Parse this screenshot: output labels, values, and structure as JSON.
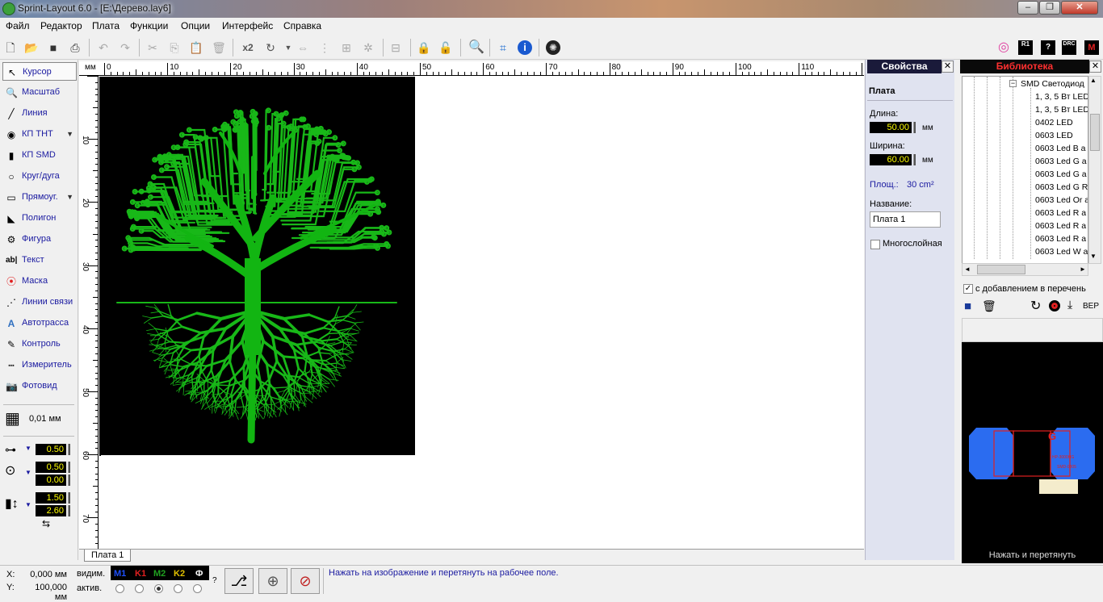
{
  "window": {
    "title": "Sprint-Layout 6.0 - [E:\\Дерево.lay6]",
    "min": "–",
    "max": "❐",
    "close": "✕"
  },
  "menu": [
    "Файл",
    "Редактор",
    "Плата",
    "Функции",
    "Опции",
    "Интерфейс",
    "Справка"
  ],
  "toolbar": {
    "x2": "x2",
    "ber": "BEP"
  },
  "tools": [
    "Курсор",
    "Масштаб",
    "Линия",
    "КП THT",
    "КП SMD",
    "Круг/дуга",
    "Прямоуг.",
    "Полигон",
    "Фигура",
    "Текст",
    "Маска",
    "Линии связи",
    "Автотрасса",
    "Контроль",
    "Измеритель",
    "Фотовид"
  ],
  "grid": {
    "value": "0,01 мм"
  },
  "params": {
    "track": "0.50",
    "pad_outer": "0.50",
    "pad_inner": "0.00",
    "smd_w": "1.50",
    "smd_h": "2.60"
  },
  "ruler": {
    "unit": "мм",
    "top": [
      "0",
      "10",
      "20",
      "30",
      "40",
      "50",
      "60",
      "70",
      "80",
      "90",
      "100",
      "110"
    ],
    "left": [
      "10",
      "20",
      "30",
      "40",
      "50",
      "60",
      "70"
    ]
  },
  "tab": {
    "label": "Плата 1"
  },
  "props": {
    "header": "Свойства",
    "section": "Плата",
    "length_label": "Длина:",
    "length": "50.00",
    "width_label": "Ширина:",
    "width": "60.00",
    "unit": "мм",
    "area_label": "Площ.:",
    "area": "30 cm²",
    "name_label": "Название:",
    "name": "Плата 1",
    "multilayer": "Многослойная"
  },
  "library": {
    "header": "Библиотека",
    "tree_root": "SMD Светодиод",
    "items": [
      "1, 3, 5 Вт LED",
      "1, 3, 5 Вт LED",
      "0402 LED",
      "0603 LED",
      "0603 Led B a",
      "0603 Led G a",
      "0603 Led G a",
      "0603 Led G R",
      "0603 Led Or a",
      "0603 Led R a",
      "0603 Led R a",
      "0603 Led R a",
      "0603 Led W a"
    ],
    "add_to_list": "с добавлением в перечень",
    "preview_hint": "Нажать и перетянуть",
    "preview_label": "G",
    "preview_text1": "HP-3000HG",
    "preview_text2": "SMD-0805"
  },
  "status": {
    "x_label": "X:",
    "x": "0,000 мм",
    "y_label": "Y:",
    "y": "100,000 мм",
    "visible": "видим.",
    "active": "актив.",
    "layers": [
      "M1",
      "K1",
      "M2",
      "K2",
      "Ф"
    ],
    "layer_colors": [
      "#1e50ff",
      "#e02020",
      "#20a020",
      "#e0c000",
      "#000000"
    ],
    "message": "Нажать на изображение и перетянуть на рабочее поле."
  }
}
